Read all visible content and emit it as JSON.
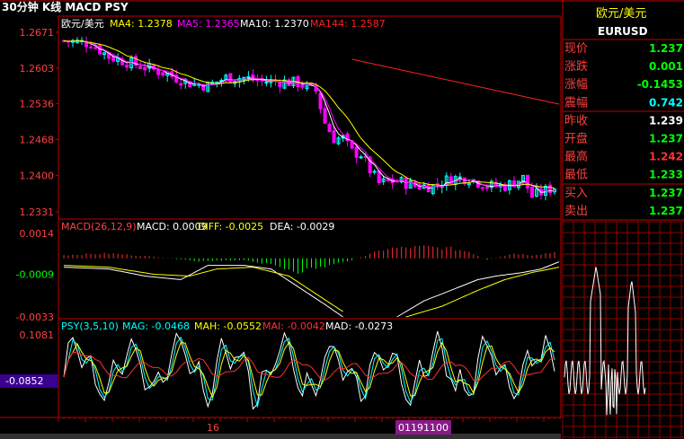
{
  "header": {
    "title": "30分钟 K线 MACD PSY"
  },
  "colors": {
    "bg": "#000000",
    "grid": "#8b0000",
    "axis": "#c00000",
    "up": "#00ffff",
    "down": "#ff00ff",
    "label": "#ff4040",
    "ma4": "#ffffff",
    "ma5": "#ff00ff",
    "ma10": "#ffff00",
    "ma144": "#ff2020",
    "macd_up": "#ff3030",
    "macd_down": "#00ff00",
    "diff": "#ffffff",
    "dea": "#ffff00",
    "psy": "#ffffff",
    "mag": "#00ffff",
    "mah": "#ffff00",
    "mai": "#ff3030",
    "mad": "#ffffff",
    "quote_green": "#00ff00",
    "quote_red": "#ff3030",
    "quote_white": "#ffffff"
  },
  "price_panel": {
    "symbol": "欧元/美元",
    "ma_labels": [
      {
        "text": "MA4: 1.2378",
        "color": "#ffff00"
      },
      {
        "text": "MA5: 1.2365",
        "color": "#ff00ff"
      },
      {
        "text": "MA10: 1.2370",
        "color": "#ffffff"
      },
      {
        "text": "MA144: 1.2587",
        "color": "#ff2020"
      }
    ],
    "yticks": [
      "1.2671",
      "1.2603",
      "1.2536",
      "1.2468",
      "1.2400",
      "1.2331"
    ]
  },
  "macd_panel": {
    "labels": [
      {
        "text": "MACD(26,12,9)",
        "color": "#ff4040"
      },
      {
        "text": "MACD: 0.0009",
        "color": "#ffffff"
      },
      {
        "text": "DIFF: -0.0025",
        "color": "#ffff00"
      },
      {
        "text": "DEA: -0.0029",
        "color": "#ffffff"
      }
    ],
    "yticks": [
      "0.0014",
      "-0.0009",
      "-0.0033"
    ]
  },
  "psy_panel": {
    "labels": [
      {
        "text": "PSY(3,5,10)",
        "color": "#00ffff"
      },
      {
        "text": "MAG: -0.0468",
        "color": "#00ffff"
      },
      {
        "text": "MAH: -0.0552",
        "color": "#ffff00"
      },
      {
        "text": "MAI: -0.0042",
        "color": "#ff3030"
      },
      {
        "text": "MAD: -0.0273",
        "color": "#ffffff"
      }
    ],
    "yticks": [
      "0.1081"
    ],
    "cursor_value": "-0.0852"
  },
  "x_axis": {
    "labels": [
      "16"
    ],
    "cursor_label": "01191100"
  },
  "quote": {
    "name": "欧元/美元",
    "code": "EURUSD",
    "rows": [
      {
        "label": "现价",
        "value": "1.237",
        "color": "#00ff00"
      },
      {
        "label": "涨跌",
        "value": "0.001",
        "color": "#00ff00"
      },
      {
        "label": "涨幅",
        "value": "-0.1453",
        "color": "#00ff00"
      },
      {
        "label": "震幅",
        "value": "0.742",
        "color": "#00ffff"
      },
      {
        "label": "昨收",
        "value": "1.239",
        "color": "#ffffff"
      },
      {
        "label": "开盘",
        "value": "1.237",
        "color": "#00ff00"
      },
      {
        "label": "最高",
        "value": "1.242",
        "color": "#ff3030"
      },
      {
        "label": "最低",
        "value": "1.233",
        "color": "#00ff00"
      },
      {
        "label": "买入",
        "value": "1.237",
        "color": "#00ff00"
      },
      {
        "label": "卖出",
        "value": "1.237",
        "color": "#00ff00"
      }
    ]
  },
  "chart_data": {
    "type": "candlestick",
    "price_range": [
      1.2331,
      1.2671
    ],
    "candle_count": 110,
    "close_path": [
      [
        0,
        1.2655
      ],
      [
        6,
        1.265
      ],
      [
        10,
        1.2625
      ],
      [
        14,
        1.2615
      ],
      [
        18,
        1.2605
      ],
      [
        22,
        1.2595
      ],
      [
        28,
        1.2575
      ],
      [
        32,
        1.257
      ],
      [
        36,
        1.2585
      ],
      [
        40,
        1.2585
      ],
      [
        44,
        1.2578
      ],
      [
        48,
        1.2578
      ],
      [
        52,
        1.2575
      ],
      [
        56,
        1.256
      ],
      [
        58,
        1.25
      ],
      [
        60,
        1.247
      ],
      [
        62,
        1.247
      ],
      [
        64,
        1.2445
      ],
      [
        66,
        1.244
      ],
      [
        68,
        1.241
      ],
      [
        70,
        1.2385
      ],
      [
        74,
        1.239
      ],
      [
        78,
        1.238
      ],
      [
        82,
        1.238
      ],
      [
        86,
        1.2395
      ],
      [
        90,
        1.2395
      ],
      [
        94,
        1.238
      ],
      [
        98,
        1.238
      ],
      [
        102,
        1.2395
      ],
      [
        104,
        1.236
      ],
      [
        108,
        1.2375
      ],
      [
        110,
        1.238
      ]
    ],
    "ma144": {
      "from": [
        64,
        1.262
      ],
      "to": [
        110,
        1.2535
      ]
    },
    "macd": {
      "range": [
        -0.0033,
        0.0014
      ],
      "histogram_path": [
        [
          0,
          0.0002
        ],
        [
          10,
          0.0003
        ],
        [
          20,
          0.0001
        ],
        [
          30,
          -0.0002
        ],
        [
          40,
          -0.0001
        ],
        [
          46,
          -0.0004
        ],
        [
          52,
          -0.0008
        ],
        [
          58,
          -0.0005
        ],
        [
          64,
          -0.0001
        ],
        [
          72,
          0.0006
        ],
        [
          80,
          0.0007
        ],
        [
          86,
          0.0006
        ],
        [
          90,
          0.0004
        ],
        [
          94,
          -0.0001
        ],
        [
          100,
          0.0003
        ],
        [
          104,
          0.0002
        ],
        [
          110,
          0.0004
        ]
      ],
      "diff_path": [
        [
          0,
          -0.0005
        ],
        [
          10,
          -0.0006
        ],
        [
          18,
          -0.001
        ],
        [
          26,
          -0.0012
        ],
        [
          32,
          -0.0004
        ],
        [
          40,
          -0.0004
        ],
        [
          46,
          -0.0006
        ],
        [
          52,
          -0.0016
        ],
        [
          58,
          -0.0026
        ],
        [
          62,
          -0.0033
        ]
      ],
      "diff_path2": [
        [
          74,
          -0.0033
        ],
        [
          80,
          -0.0024
        ],
        [
          86,
          -0.0018
        ],
        [
          92,
          -0.0012
        ],
        [
          96,
          -0.001
        ],
        [
          102,
          -0.0008
        ],
        [
          106,
          -0.0006
        ],
        [
          110,
          -0.0002
        ]
      ],
      "dea_path": [
        [
          0,
          -0.0004
        ],
        [
          10,
          -0.0005
        ],
        [
          20,
          -0.0009
        ],
        [
          28,
          -0.001
        ],
        [
          34,
          -0.0006
        ],
        [
          42,
          -0.0005
        ],
        [
          50,
          -0.001
        ],
        [
          56,
          -0.002
        ],
        [
          62,
          -0.003
        ]
      ],
      "dea_path2": [
        [
          76,
          -0.0033
        ],
        [
          84,
          -0.0027
        ],
        [
          92,
          -0.0018
        ],
        [
          98,
          -0.0012
        ],
        [
          104,
          -0.0008
        ],
        [
          110,
          -0.0005
        ]
      ]
    },
    "psy": {
      "range": [
        -0.16,
        0.12
      ]
    },
    "mini_chart": {
      "range": [
        -1,
        1
      ]
    }
  }
}
